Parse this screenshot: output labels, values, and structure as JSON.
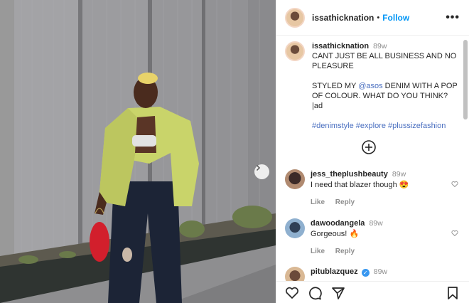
{
  "post": {
    "username": "issathicknation",
    "follow_label": "Follow",
    "more_label": "•••"
  },
  "caption": {
    "username": "issathicknation",
    "time": "89w",
    "line1": "CANT JUST BE ALL BUSINESS AND NO PLEASURE",
    "styled_prefix": "STYLED MY ",
    "mention": "@asos",
    "styled_suffix": " DENIM WITH A POP OF COLOUR. WHAT DO YOU THINK? |ad",
    "hashtags": [
      "#denimstyle",
      "#explore",
      "#plussizefashion"
    ]
  },
  "comments": [
    {
      "username": "jess_theplushbeauty",
      "time": "89w",
      "text": "I need that blazer though",
      "emoji": "😍",
      "like": "Like",
      "reply": "Reply",
      "avatar_color": "#3b2a28"
    },
    {
      "username": "dawoodangela",
      "time": "89w",
      "text": "Gorgeous!",
      "emoji": "🔥",
      "like": "Like",
      "reply": "Reply",
      "avatar_color": "#7fa3c4"
    },
    {
      "username": "pitublazquez",
      "time": "89w",
      "text": "",
      "verified": true,
      "avatar_color": "#c9a27e"
    }
  ],
  "icons": {
    "next": "chevron-right-icon",
    "more": "more-options-icon",
    "load_more": "plus-circle-icon",
    "like": "heart-icon",
    "comment": "comment-icon",
    "share": "send-icon",
    "save": "bookmark-icon"
  },
  "colors": {
    "link_blue": "#0095f6",
    "hashtag": "#4a6fc0",
    "muted": "#8e8e8e"
  }
}
